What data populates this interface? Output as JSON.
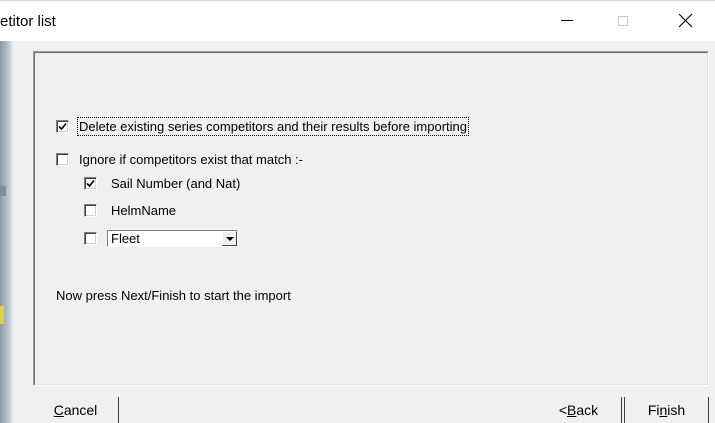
{
  "window": {
    "title": "etitor list",
    "minimize_label": "—",
    "maximize_label": "□",
    "close_label": "✕"
  },
  "options": {
    "delete_existing": {
      "label": "Delete existing series competitors and their results before importing",
      "checked": true
    },
    "ignore_if_match": {
      "label": "Ignore if competitors exist that match :-",
      "checked": false
    },
    "sail_number": {
      "label": "Sail Number (and Nat)",
      "checked": true
    },
    "helm_name": {
      "label": "HelmName",
      "checked": false
    },
    "fleet": {
      "checked": false,
      "combo_value": "Fleet"
    }
  },
  "instruction": "Now press Next/Finish to start the import",
  "buttons": {
    "cancel": {
      "pre": "",
      "accel": "C",
      "post": "ancel"
    },
    "back": {
      "pre": "< ",
      "accel": "B",
      "post": "ack"
    },
    "finish": {
      "pre": "Fi",
      "accel": "n",
      "post": "ish"
    }
  },
  "icons": {
    "check": "check-mark-icon",
    "dropdown": "chevron-down-icon",
    "close": "close-icon"
  }
}
